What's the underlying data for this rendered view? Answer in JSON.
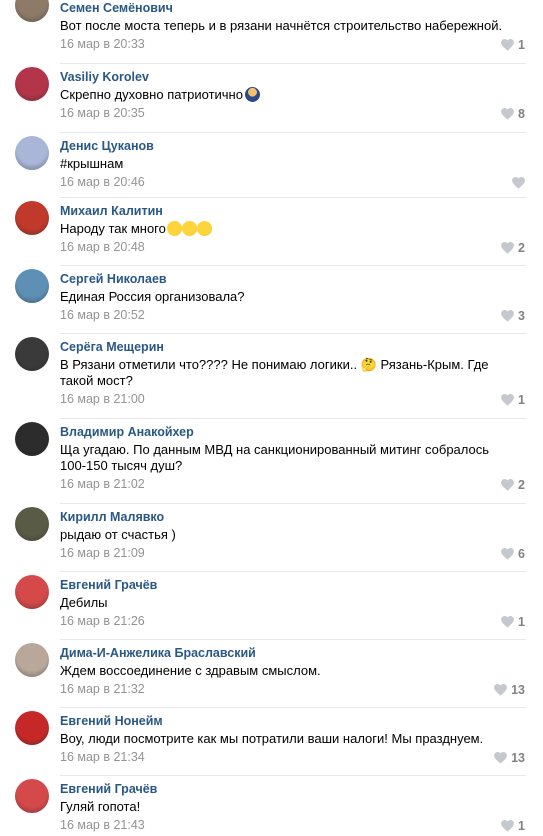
{
  "comments": [
    {
      "author": "Семен Семёнович",
      "text": "Вот после моста теперь и в рязани начнётся строительство набережной.",
      "date": "16 мар в 20:33",
      "likes": "1",
      "avatar_icon": "avatar-photo",
      "avatar_color": "#8d7b68"
    },
    {
      "author": "Vasiliy Korolev",
      "text": "Скрепно духовно патриотично",
      "emoji": "person-emoji",
      "date": "16 мар в 20:35",
      "likes": "8",
      "avatar_icon": "avatar-photo",
      "avatar_color": "#b4354a"
    },
    {
      "author": "Денис Цуканов",
      "text": "#крышнам",
      "date": "16 мар в 20:46",
      "likes": "",
      "avatar_icon": "avatar-photo",
      "avatar_color": "#a9b6d8"
    },
    {
      "author": "Михаил Калитин",
      "text": "Народу так много",
      "emoji": "rofl-emoji-x3",
      "date": "16 мар в 20:48",
      "likes": "2",
      "avatar_icon": "avatar-photo",
      "avatar_color": "#c0392b"
    },
    {
      "author": "Сергей Николаев",
      "text": "Единая Россия организовала?",
      "date": "16 мар в 20:52",
      "likes": "3",
      "avatar_icon": "avatar-photo",
      "avatar_color": "#5e8fb5"
    },
    {
      "author": "Серёга Мещерин",
      "text": "В Рязани отметили что???? Не понимаю логики.. 🤔 Рязань-Крым. Где такой мост?",
      "date": "16 мар в 21:00",
      "likes": "1",
      "avatar_icon": "avatar-photo",
      "avatar_color": "#3a3a3a"
    },
    {
      "author": "Владимир Анакойхер",
      "text": "Ща угадаю. По данным МВД на санкционированный митинг собралось 100-150 тысяч душ?",
      "date": "16 мар в 21:02",
      "likes": "2",
      "avatar_icon": "avatar-photo",
      "avatar_color": "#2c2c2c"
    },
    {
      "author": "Кирилл Малявко",
      "text": "рыдаю от счастья )",
      "date": "16 мар в 21:09",
      "likes": "6",
      "avatar_icon": "avatar-photo",
      "avatar_color": "#5a5b45"
    },
    {
      "author": "Евгений Грачёв",
      "text": "Дебилы",
      "date": "16 мар в 21:26",
      "likes": "1",
      "avatar_icon": "avatar-photo",
      "avatar_color": "#d4494a"
    },
    {
      "author": "Дима-И-Анжелика Браславский",
      "text": "Ждем воссоединение с здравым смыслом.",
      "date": "16 мар в 21:32",
      "likes": "13",
      "avatar_icon": "avatar-photo",
      "avatar_color": "#b9a89a"
    },
    {
      "author": "Евгений Нонейм",
      "text": "Воу, люди посмотрите как мы потратили ваши налоги! Мы празднуем.",
      "date": "16 мар в 21:34",
      "likes": "13",
      "avatar_icon": "angry-bird-avatar",
      "avatar_color": "#c62828"
    },
    {
      "author": "Евгений Грачёв",
      "text": "Гуляй гопота!",
      "date": "16 мар в 21:43",
      "likes": "1",
      "avatar_icon": "avatar-photo",
      "avatar_color": "#d4494a"
    }
  ],
  "colors": {
    "author": "#2a5885",
    "meta": "#939393",
    "like": "#828282",
    "divider": "#e7e8ec"
  },
  "icons": {
    "like": "heart-icon"
  }
}
